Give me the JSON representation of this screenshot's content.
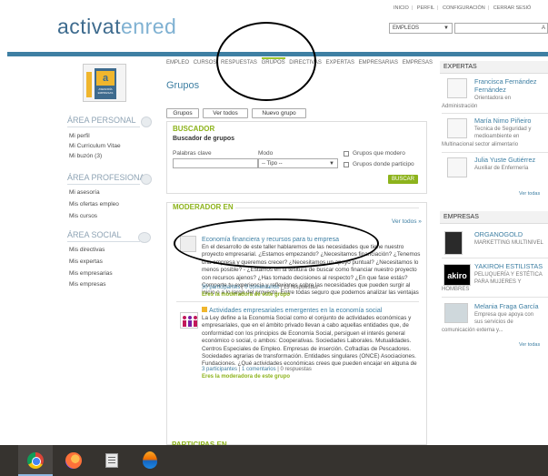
{
  "header": {
    "logo_part1": "activat",
    "logo_part2": "enred",
    "top_links": [
      "INICIO",
      "PERFIL",
      "CONFIGURACIÓN",
      "CERRAR SESIÓ"
    ],
    "search_category": "EMPLEOS",
    "search_button": "A"
  },
  "avatar": {
    "letter": "a",
    "caption": "ASESORÍA EMPRESAS"
  },
  "sidebar": {
    "sections": [
      {
        "title": "ÁREA PERSONAL",
        "icon": "user-icon",
        "items": [
          "Mi perfil",
          "Mi Curriculum Vitae",
          "Mi buzón (3)"
        ]
      },
      {
        "title": "ÁREA PROFESIONAL",
        "icon": "user-icon",
        "items": [
          "Mi asesoría",
          "Mis ofertas empleo",
          "Mis cursos"
        ]
      },
      {
        "title": "ÁREA SOCIAL",
        "icon": "group-icon",
        "items": [
          "Mis directivas",
          "Mis expertas",
          "Mis empresarias",
          "Mis empresas"
        ]
      }
    ]
  },
  "nav": {
    "items": [
      "EMPLEO",
      "CURSOS",
      "RESPUESTAS",
      "GRUPOS",
      "DIRECTIVAS",
      "EXPERTAS",
      "EMPRESARIAS",
      "EMPRESAS"
    ],
    "active": "GRUPOS"
  },
  "main": {
    "title": "Grupos",
    "tabs": [
      "Grupos",
      "Ver todos",
      "Nuevo grupo"
    ],
    "buscador": {
      "title": "BUSCADOR",
      "subtitle": "Buscador de grupos",
      "keywords_label": "Palabras clave",
      "keywords_value": "",
      "mode_label": "Modo",
      "mode_value": "-- Tipo --",
      "check1": "Grupos que modero",
      "check2": "Grupos donde participo",
      "search_button": "BUSCAR"
    },
    "moderador": {
      "title": "MODERADOR EN",
      "see_all": "Ver todos »",
      "groups": [
        {
          "title": "Economía financiera y recursos para tu empresa",
          "description": "En el desarrollo de este taller hablaremos de las necesidades que tiene nuestro proyecto empresarial. ¿Estamos empezando? ¿Necesitamos financiación? ¿Tenemos una empresa y queremos crecer? ¿Necesitamos un apoyo puntual? ¿Necesitamos lo menos posible? - ¿Estamos en la tesitura de buscar como financiar nuestro proyecto con recursos ajenos? ¿Has tomado decisiones al respecto? ¿En que fase estás? Comparte tu experiencia y reflexiones sobre las necesidades que pueden surgir al inicio o a lo largo del proyecto. Entre todas seguro que podemos analizar las ventajas e inconvenientes de cada elección.",
          "participants": "30 participantes",
          "comments": "0 comentarios",
          "answers": "13 respuestas",
          "moderator_note": "Eres la moderadora de este grupo"
        },
        {
          "title": "Actividades empresariales emergentes en la economía social",
          "description": "La Ley define a la Economía Social como el conjunto de actividades económicas y empresariales, que en el ámbito privado llevan a cabo aquellas entidades que, de conformidad con los principios de Economía Social, persiguen el interés general económico o social, o ambos: Cooperativas. Sociedades Laborales. Mutualidades. Centros Especiales de Empleo. Empresas de inserción. Cofradías de Pescadores. Sociedades agrarias de transformación. Entidades singulares (ONCE) Asociaciones. Fundaciones. ¿Qué actividades económicas crees que pueden encajar en alguna de estas formas jurídicas?",
          "participants": "3 participantes",
          "comments": "1 comentarios",
          "answers": "0 respuestas",
          "moderator_note": "Eres la moderadora de este grupo"
        }
      ]
    },
    "participas_title": "PARTICIPAS EN"
  },
  "right": {
    "expertas": {
      "title": "EXPERTAS",
      "people": [
        {
          "name1": "Francisca Fernández",
          "name2": "Fernández",
          "desc1": "Orientadora en",
          "desc2": "Administración"
        },
        {
          "name1": "María Nimo Piñeiro",
          "desc1": "Tecnica de Seguridad y",
          "desc2": "medioambiente en",
          "desc3": "Multinacional sector alimentario"
        },
        {
          "name1": "Julia Yuste Gutiérrez",
          "desc1": "Auxiliar de Enfermería"
        }
      ],
      "see_all": "Ver todas"
    },
    "empresas": {
      "title": "EMPRESAS",
      "items": [
        {
          "name": "ORGANOGOLD",
          "desc1": "MARKETTING MULTINIVEL"
        },
        {
          "name": "YAKIROH ESTILISTAS",
          "desc1": "PELUQUERÍA Y ESTÉTICA",
          "desc2": "PARA MUJERES Y",
          "desc3": "HOMBRES",
          "logo": "akiro"
        },
        {
          "name": "Melania Fraga García",
          "desc1": "Empresa que apoya con",
          "desc2": "sus servicios de",
          "desc3": "comunicación externa y..."
        }
      ],
      "see_all": "Ver todas"
    }
  },
  "colors": {
    "brand_blue": "#3e7fa3",
    "accent_green": "#8db31c",
    "annotation": "#000000"
  }
}
